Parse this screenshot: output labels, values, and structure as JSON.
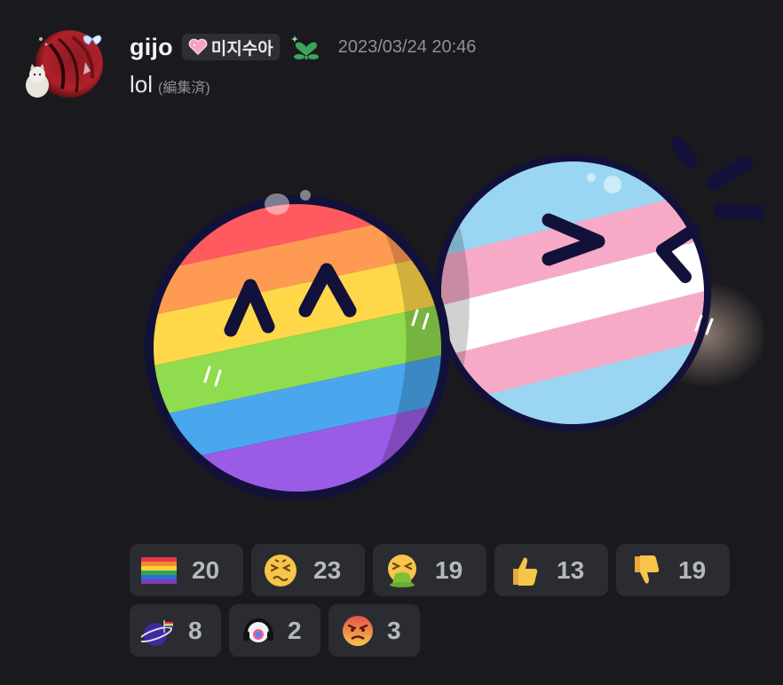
{
  "message": {
    "username": "gijo",
    "server_tag": "미지수아",
    "timestamp": "2023/03/24 20:46",
    "text": "lol",
    "edited_label": "(編集済)"
  },
  "sticker": {
    "icon": "rainbow-and-trans-flag-balls-sticker"
  },
  "reactions": [
    {
      "emoji": "rainbow-flag",
      "count": "20"
    },
    {
      "emoji": "persevering-face",
      "count": "23"
    },
    {
      "emoji": "vomiting-face",
      "count": "19"
    },
    {
      "emoji": "thumbs-up",
      "count": "13"
    },
    {
      "emoji": "thumbs-down",
      "count": "19"
    },
    {
      "emoji": "custom-planet-flag",
      "count": "8"
    },
    {
      "emoji": "custom-headphone-face",
      "count": "2"
    },
    {
      "emoji": "angry-face",
      "count": "3"
    }
  ],
  "colors": {
    "background": "#1a1a1e",
    "reaction_bg": "#2b2c31",
    "role_icon": "#3ba55c"
  }
}
